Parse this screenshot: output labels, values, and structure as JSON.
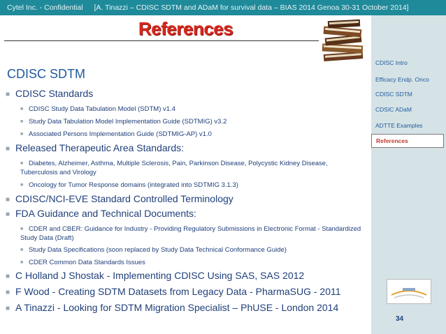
{
  "header": {
    "confidential": "Cytel Inc. - Confidential",
    "citation": "[A. Tinazzi – CDISC SDTM and ADaM for survival data – BIAS 2014 Genoa 30-31 October 2014]"
  },
  "slide": {
    "title": "References",
    "heading": "CDISC SDTM",
    "bullets": [
      {
        "label": "CDISC Standards"
      },
      {
        "label": "CDISC Study Data Tabulation Model (SDTM) v1.4"
      },
      {
        "label": "Study Data Tabulation Model Implementation Guide (SDTMIG) v3.2"
      },
      {
        "label": "Associated Persons Implementation Guide (SDTMIG-AP) v1.0"
      },
      {
        "label": "Released Therapeutic Area Standards:"
      },
      {
        "label": "Diabetes, Alzheimer, Asthma, Multiple Sclerosis, Pain, Parkinson Disease, Polycystic Kidney Disease, Tuberculosis and Virology"
      },
      {
        "label": "Oncology for Tumor Response domains (integrated into SDTMIG 3.1.3)"
      },
      {
        "label": "CDISC/NCI-EVE Standard Controlled Terminology"
      },
      {
        "label": "FDA Guidance and Technical Documents:"
      },
      {
        "label": "CDER and CBER: Guidance for Industry - Providing Regulatory Submissions in Electronic Format - Standardized Study Data (Draft)"
      },
      {
        "label": "Study Data Specifications (soon replaced by Study Data Technical Conformance Guide)"
      },
      {
        "label": "CDER Common Data Standards Issues"
      },
      {
        "label": "C Holland J Shostak - Implementing CDISC Using SAS, SAS 2012"
      },
      {
        "label": "F Wood -  Creating SDTM Datasets from Legacy Data - PharmaSUG - 2011"
      },
      {
        "label": "A Tinazzi - Looking for SDTM Migration Specialist – PhUSE - London 2014"
      }
    ],
    "page_number": "34"
  },
  "sidebar": {
    "items": [
      {
        "label": "CDISC Intro"
      },
      {
        "label": "Efficacy Endp. Onco"
      },
      {
        "label": "CDISC SDTM"
      },
      {
        "label": "CDSIC ADaM"
      },
      {
        "label": "ADTTE Examples"
      },
      {
        "label": "References"
      }
    ]
  },
  "colors": {
    "header_bar": "#1f8a9a",
    "sidebar_bg": "#d5e3e6",
    "title_red": "#d9261c",
    "body_text": "#1f3f7a",
    "heading_blue": "#1f5aa0",
    "active_nav": "#c0392b"
  }
}
